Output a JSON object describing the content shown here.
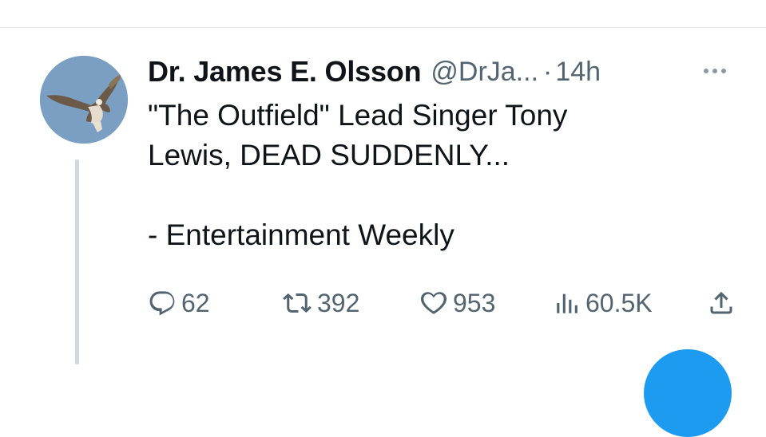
{
  "tweet": {
    "display_name": "Dr. James E. Olsson",
    "handle": "@DrJa...",
    "separator": "·",
    "time": "14h",
    "text_line1": "\"The Outfield\" Lead Singer Tony",
    "text_line2": "Lewis, DEAD SUDDENLY...",
    "text_line3": "- Entertainment Weekly"
  },
  "actions": {
    "replies": "62",
    "retweets": "392",
    "likes": "953",
    "views": "60.5K"
  },
  "icons": {
    "more": "more-dots-icon",
    "reply": "reply-bubble-icon",
    "retweet": "retweet-arrows-icon",
    "like": "heart-icon",
    "views": "views-bars-icon",
    "share": "share-upload-icon"
  },
  "colors": {
    "text": "#0f1419",
    "secondary": "#536471",
    "thread_line": "#cfd9de",
    "accent": "#1d9bf0"
  }
}
